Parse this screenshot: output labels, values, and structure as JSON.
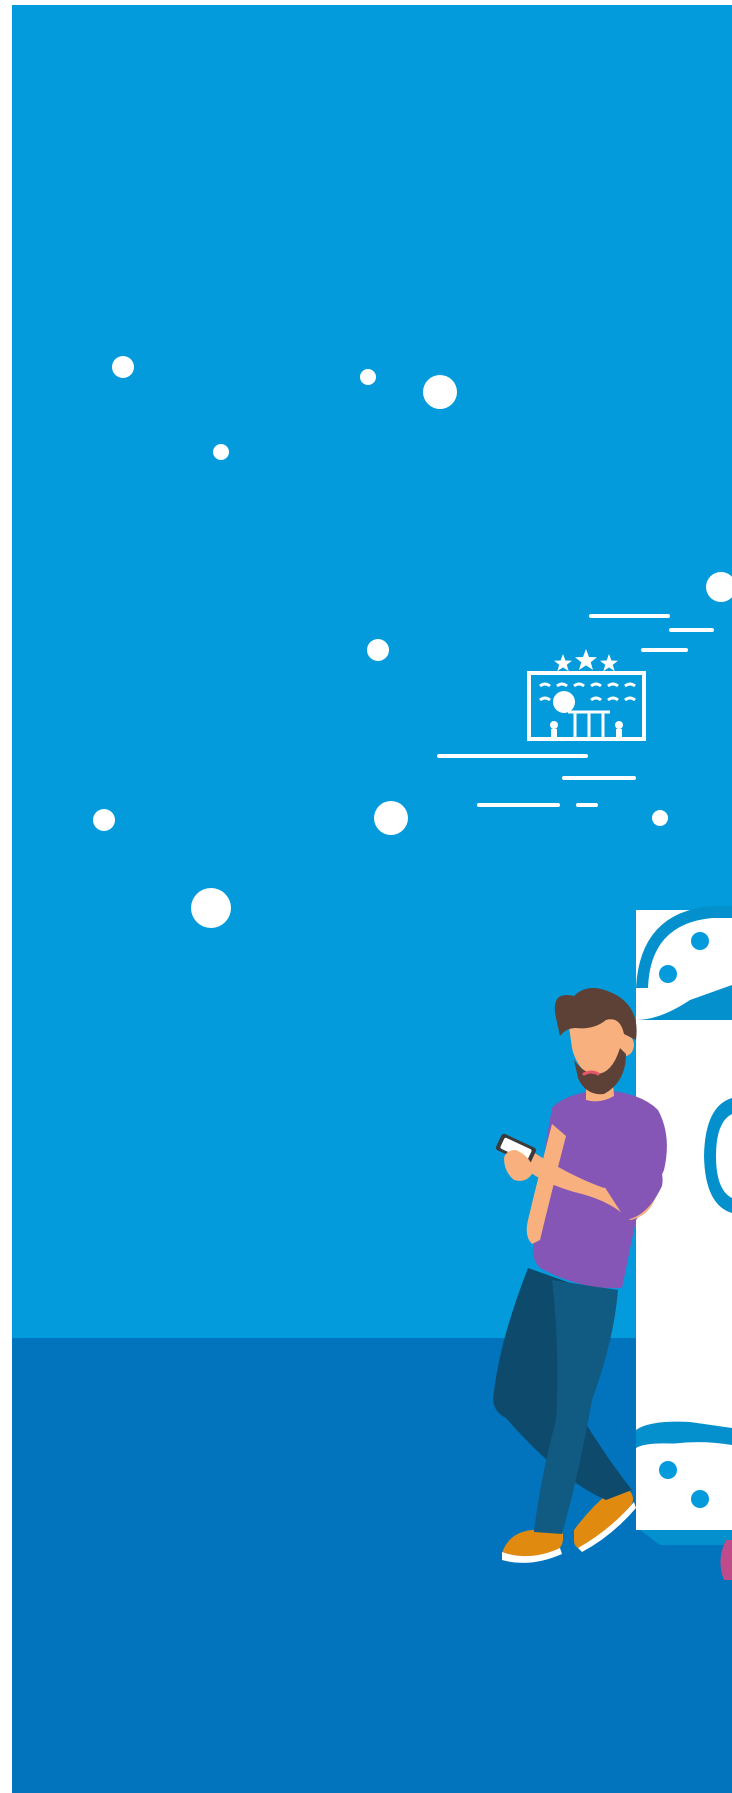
{
  "illustration": {
    "subject": "person-leaning-on-phone-with-hotel-icon",
    "hotel_stars": 3
  },
  "colors": {
    "page_background": "#ffffff",
    "sky": "#039bdc",
    "floor": "#0174bd",
    "white": "#ffffff",
    "hair": "#5e4136",
    "skin": "#f8b17e",
    "shirt": "#8656b6",
    "jeans_dark": "#0d4a6b",
    "jeans_light": "#115a82",
    "shoes": "#e08a10",
    "phone_screen": "#ffffff",
    "phone_body": "#3b3b3b",
    "phone_ring": "#0390cc",
    "accent_pink": "#c04b8a"
  }
}
